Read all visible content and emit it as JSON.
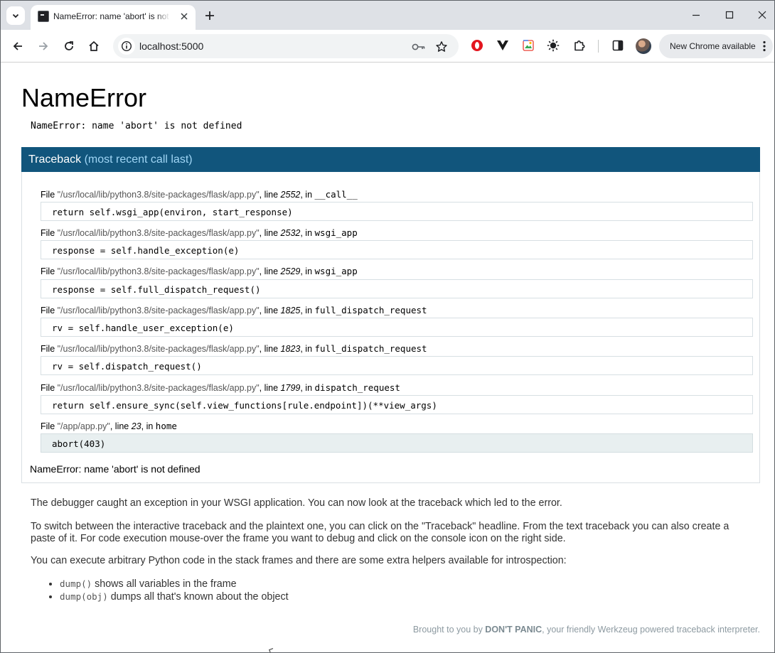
{
  "browser": {
    "tab": {
      "title": "NameError: name 'abort' is not defined // Werkzeug Debugger"
    },
    "address_bar": {
      "url": "localhost:5000"
    },
    "update_button": {
      "label": "New Chrome available"
    }
  },
  "page": {
    "title": "NameError",
    "error_message": "NameError: name 'abort' is not defined",
    "traceback_header": {
      "label": "Traceback",
      "sub_label": "(most recent call last)"
    },
    "frames": [
      {
        "file_prefix": "File ",
        "filename": "\"/usr/local/lib/python3.8/site-packages/flask/app.py\"",
        "line_prefix": ", line ",
        "line": "2552",
        "func_prefix": ", in ",
        "function": "__call__",
        "code": "return self.wsgi_app(environ, start_response)"
      },
      {
        "file_prefix": "File ",
        "filename": "\"/usr/local/lib/python3.8/site-packages/flask/app.py\"",
        "line_prefix": ", line ",
        "line": "2532",
        "func_prefix": ", in ",
        "function": "wsgi_app",
        "code": "response = self.handle_exception(e)"
      },
      {
        "file_prefix": "File ",
        "filename": "\"/usr/local/lib/python3.8/site-packages/flask/app.py\"",
        "line_prefix": ", line ",
        "line": "2529",
        "func_prefix": ", in ",
        "function": "wsgi_app",
        "code": "response = self.full_dispatch_request()"
      },
      {
        "file_prefix": "File ",
        "filename": "\"/usr/local/lib/python3.8/site-packages/flask/app.py\"",
        "line_prefix": ", line ",
        "line": "1825",
        "func_prefix": ", in ",
        "function": "full_dispatch_request",
        "code": "rv = self.handle_user_exception(e)"
      },
      {
        "file_prefix": "File ",
        "filename": "\"/usr/local/lib/python3.8/site-packages/flask/app.py\"",
        "line_prefix": ", line ",
        "line": "1823",
        "func_prefix": ", in ",
        "function": "full_dispatch_request",
        "code": "rv = self.dispatch_request()"
      },
      {
        "file_prefix": "File ",
        "filename": "\"/usr/local/lib/python3.8/site-packages/flask/app.py\"",
        "line_prefix": ", line ",
        "line": "1799",
        "func_prefix": ", in ",
        "function": "dispatch_request",
        "code": "return self.ensure_sync(self.view_functions[rule.endpoint])(**view_args)"
      },
      {
        "file_prefix": "File ",
        "filename": "\"/app/app.py\"",
        "line_prefix": ", line ",
        "line": "23",
        "func_prefix": ", in ",
        "function": "home",
        "code": "abort(403)"
      }
    ],
    "exception_footer": "NameError: name 'abort' is not defined",
    "explanations": [
      "The debugger caught an exception in your WSGI application. You can now look at the traceback which led to the error.",
      "To switch between the interactive traceback and the plaintext one, you can click on the \"Traceback\" headline. From the text traceback you can also create a paste of it. For code execution mouse-over the frame you want to debug and click on the console icon on the right side.",
      "You can execute arbitrary Python code in the stack frames and there are some extra helpers available for introspection:"
    ],
    "helpers": [
      {
        "code": "dump()",
        "text": " shows all variables in the frame"
      },
      {
        "code": "dump(obj)",
        "text": " dumps all that's known about the object"
      }
    ],
    "footer": {
      "prefix": "Brought to you by ",
      "brand": "DON'T PANIC",
      "suffix": ", your friendly Werkzeug powered traceback interpreter."
    }
  },
  "colors": {
    "traceback_header_bg": "#11557c",
    "traceback_sub_label": "#9fd5f5",
    "current_frame_bg": "#e8eff0"
  },
  "icons": {
    "tab_search": "chevron-down-icon",
    "favicon": "terminal-icon",
    "back": "arrow-left-icon",
    "forward": "arrow-right-icon",
    "reload": "reload-icon",
    "home": "home-icon",
    "site_info": "info-icon",
    "password": "key-icon",
    "bookmark": "star-icon"
  }
}
